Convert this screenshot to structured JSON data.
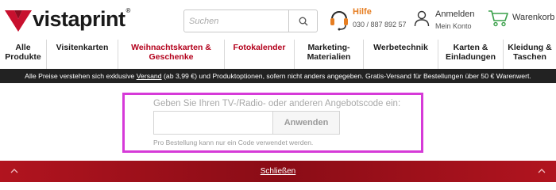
{
  "header": {
    "logo_text": "vistaprint",
    "logo_reg": "®",
    "search": {
      "placeholder": "Suchen"
    },
    "help": {
      "title": "Hilfe",
      "phone": "030 / 887 892 57"
    },
    "account": {
      "title": "Anmelden",
      "subtitle": "Mein Konto"
    },
    "cart": {
      "label": "Warenkorb"
    }
  },
  "nav": {
    "items": [
      {
        "label": "Alle\nProdukte",
        "highlight": false
      },
      {
        "label": "Visitenkarten",
        "highlight": false
      },
      {
        "label": "Weihnachtskarten &\nGeschenke",
        "highlight": true
      },
      {
        "label": "Fotokalender",
        "highlight": true
      },
      {
        "label": "Marketing-\nMaterialien",
        "highlight": false
      },
      {
        "label": "Werbetechnik",
        "highlight": false
      },
      {
        "label": "Karten &\nEinladungen",
        "highlight": false
      },
      {
        "label": "Kleidung &\nTaschen",
        "highlight": false
      }
    ]
  },
  "notice": {
    "before": "Alle Preise verstehen sich exklusive ",
    "link": "Versand",
    "after": " (ab 3,99 €) und Produktoptionen, sofern nicht anders angegeben. Gratis-Versand für Bestellungen über 50 € Warenwert."
  },
  "promo": {
    "label": "Geben Sie Ihren TV-/Radio- oder anderen Angebotscode ein:",
    "input_value": "",
    "button_label": "Anwenden",
    "note": "Pro Bestellung kann nur ein Code verwendet werden."
  },
  "footer": {
    "close_label": "Schließen"
  },
  "colors": {
    "brand_red": "#b3001b",
    "highlight_box": "#d63ad8",
    "help_orange": "#e67e22",
    "cart_green": "#3aa04a"
  }
}
